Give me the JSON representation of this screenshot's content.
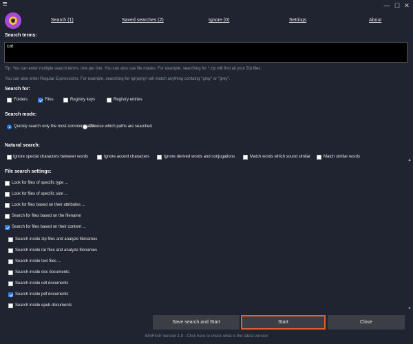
{
  "titlebar": {
    "menu_icon": "hamburger-icon",
    "controls": [
      "—",
      "☐",
      "✕"
    ]
  },
  "tabs": [
    {
      "label": "Search (1)"
    },
    {
      "label": "Saved searches (2)"
    },
    {
      "label": "Ignore (0)"
    },
    {
      "label": "Settings"
    },
    {
      "label": "About"
    }
  ],
  "search_terms": {
    "heading": "Search terms:",
    "value": "cat",
    "tip1": "Tip: You can enter multiple search terms, one per line. You can also use file masks. For example, searching for *.zip will find all your Zip files.",
    "tip2": "You can also enter Regular Expressions. For example, searching for \\gr(a|e)y\\ will match anything containg \"gray\" or \"grey\"."
  },
  "search_for": {
    "heading": "Search for:",
    "options": [
      {
        "label": "Folders",
        "checked": false
      },
      {
        "label": "Files",
        "checked": true
      },
      {
        "label": "Registry keys",
        "checked": false
      },
      {
        "label": "Registry entries",
        "checked": false
      }
    ]
  },
  "search_mode": {
    "heading": "Search mode:",
    "options": [
      {
        "label": "Quickly search only the most common paths",
        "selected": true
      },
      {
        "label": "Choose which paths are searched",
        "selected": false
      }
    ]
  },
  "natural_search": {
    "heading": "Natural search:",
    "options": [
      {
        "label": "Ignore special characters between words",
        "checked": false
      },
      {
        "label": "Ignore accent characters",
        "checked": false
      },
      {
        "label": "Ignore derived words and conjugations",
        "checked": false
      },
      {
        "label": "Match words which sound similar",
        "checked": false
      },
      {
        "label": "Match similar words",
        "checked": false
      }
    ]
  },
  "file_search_settings": {
    "heading": "File search settings:",
    "options": [
      {
        "label": "Look for files of specific type ...",
        "checked": false
      },
      {
        "label": "Look for files of specific size ...",
        "checked": false
      },
      {
        "label": "Look for files based on their attributes ...",
        "checked": false
      },
      {
        "label": "Search for files based on the filename",
        "checked": false
      },
      {
        "label": "Search for files based on their content ...",
        "checked": true
      }
    ],
    "content_options": [
      {
        "label": "Search inside zip files and analyze filenames",
        "checked": false
      },
      {
        "label": "Search inside rar files and analyze filenames",
        "checked": false
      },
      {
        "label": "Search inside text files ...",
        "checked": false
      },
      {
        "label": "Search inside doc documents",
        "checked": false
      },
      {
        "label": "Search inside odt documents",
        "checked": false
      },
      {
        "label": "Search inside pdf documents",
        "checked": true
      },
      {
        "label": "Search inside epub documents",
        "checked": false
      }
    ]
  },
  "buttons": {
    "save_start": "Save search and Start",
    "start": "Start",
    "close": "Close"
  },
  "footer": "WinFindr Version 1.8 - Click here to check what is the latest version",
  "colors": {
    "background": "#1f2430",
    "accent": "#2f78e0",
    "start_border": "#e0602e",
    "button": "#3b3e44"
  }
}
